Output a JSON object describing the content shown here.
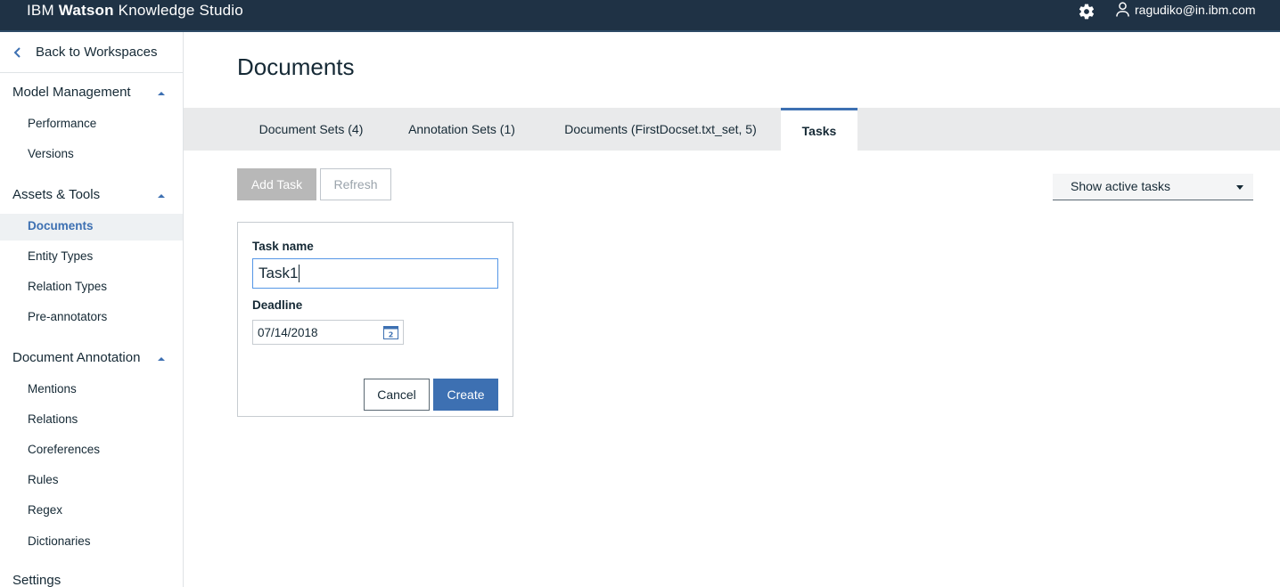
{
  "header": {
    "brand_prefix": "IBM",
    "brand_bold": "Watson",
    "brand_suffix": "Knowledge Studio",
    "user_email": "ragudiko@in.ibm.com",
    "settings_icon": "gear-icon",
    "user_icon": "user-icon"
  },
  "sidebar": {
    "back_label": "Back to Workspaces",
    "sections": [
      {
        "title": "Model Management",
        "items": [
          "Performance",
          "Versions"
        ]
      },
      {
        "title": "Assets & Tools",
        "items": [
          "Documents",
          "Entity Types",
          "Relation Types",
          "Pre-annotators"
        ]
      },
      {
        "title": "Document Annotation",
        "items": [
          "Mentions",
          "Relations",
          "Coreferences",
          "Rules",
          "Regex",
          "Dictionaries"
        ]
      },
      {
        "title": "Settings",
        "items": []
      }
    ],
    "active_item": "Documents"
  },
  "page": {
    "title": "Documents"
  },
  "tabs": [
    {
      "label": "Document Sets (4)"
    },
    {
      "label": "Annotation Sets (1)"
    },
    {
      "label": "Documents (FirstDocset.txt_set, 5)"
    },
    {
      "label": "Tasks",
      "active": true
    }
  ],
  "toolbar": {
    "add_task": "Add Task",
    "refresh": "Refresh",
    "filter_selected": "Show active tasks"
  },
  "task_form": {
    "task_name_label": "Task name",
    "task_name_value": "Task1",
    "deadline_label": "Deadline",
    "deadline_value": "07/14/2018",
    "calendar_day": "2",
    "cancel": "Cancel",
    "create": "Create"
  },
  "colors": {
    "header_bg": "#1f3245",
    "accent": "#3d70b2",
    "tabbar_bg": "#e9eaeb"
  }
}
